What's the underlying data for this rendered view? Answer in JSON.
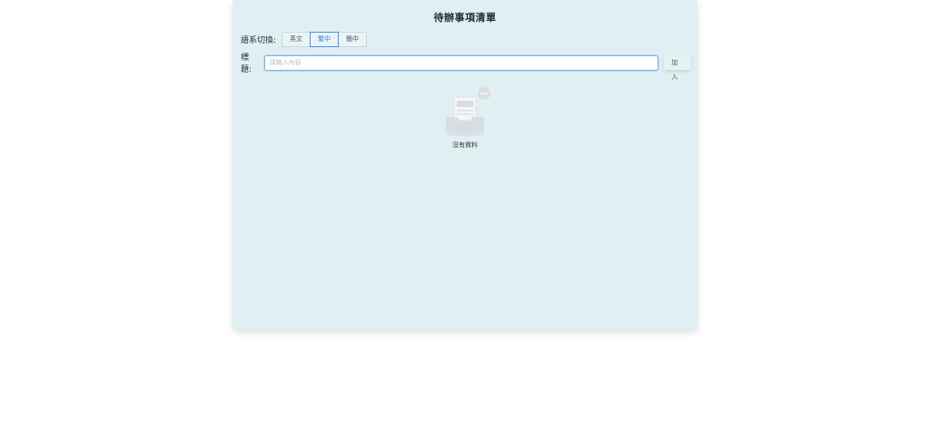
{
  "app": {
    "title": "待辦事項清單"
  },
  "language": {
    "label": "語系切換:",
    "options": [
      "英文",
      "繁中",
      "簡中"
    ],
    "selected": "繁中"
  },
  "todo_form": {
    "label": "標題:",
    "input_value": "",
    "input_placeholder": "請輸入內容",
    "add_label": "加入"
  },
  "empty_state": {
    "icon": "empty-inbox-icon",
    "text": "沒有資料"
  },
  "colors": {
    "card_background": "#e0f0f2",
    "accent": "#4a90e2"
  }
}
